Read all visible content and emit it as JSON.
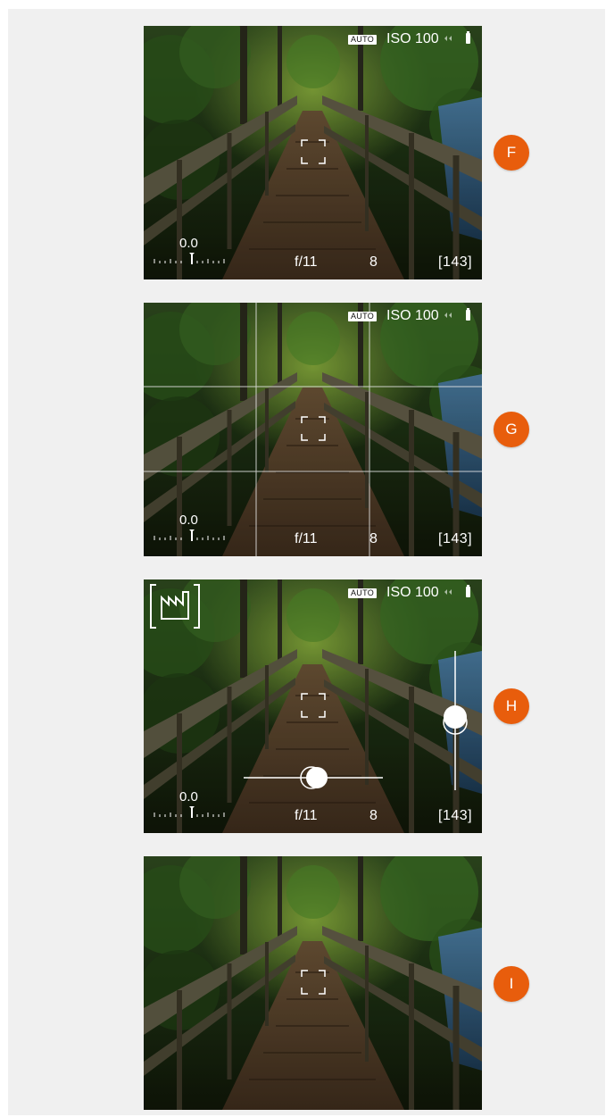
{
  "screens": [
    {
      "label": "F",
      "iso_badge": "AUTO",
      "iso": "ISO 100",
      "ev": "0.0",
      "aperture": "f/11",
      "shutter": "8",
      "shots": "[143]"
    },
    {
      "label": "G",
      "iso_badge": "AUTO",
      "iso": "ISO 100",
      "ev": "0.0",
      "aperture": "f/11",
      "shutter": "8",
      "shots": "[143]"
    },
    {
      "label": "H",
      "iso_badge": "AUTO",
      "iso": "ISO 100",
      "ev": "0.0",
      "aperture": "f/11",
      "shutter": "8",
      "shots": "[143]"
    },
    {
      "label": "I"
    }
  ],
  "colors": {
    "marker": "#e85d0c",
    "background": "#f0f0f0"
  },
  "icons": {
    "mode": "factory-mode-icon",
    "battery": "battery-icon",
    "focus": "af-focus-frame-icon"
  }
}
